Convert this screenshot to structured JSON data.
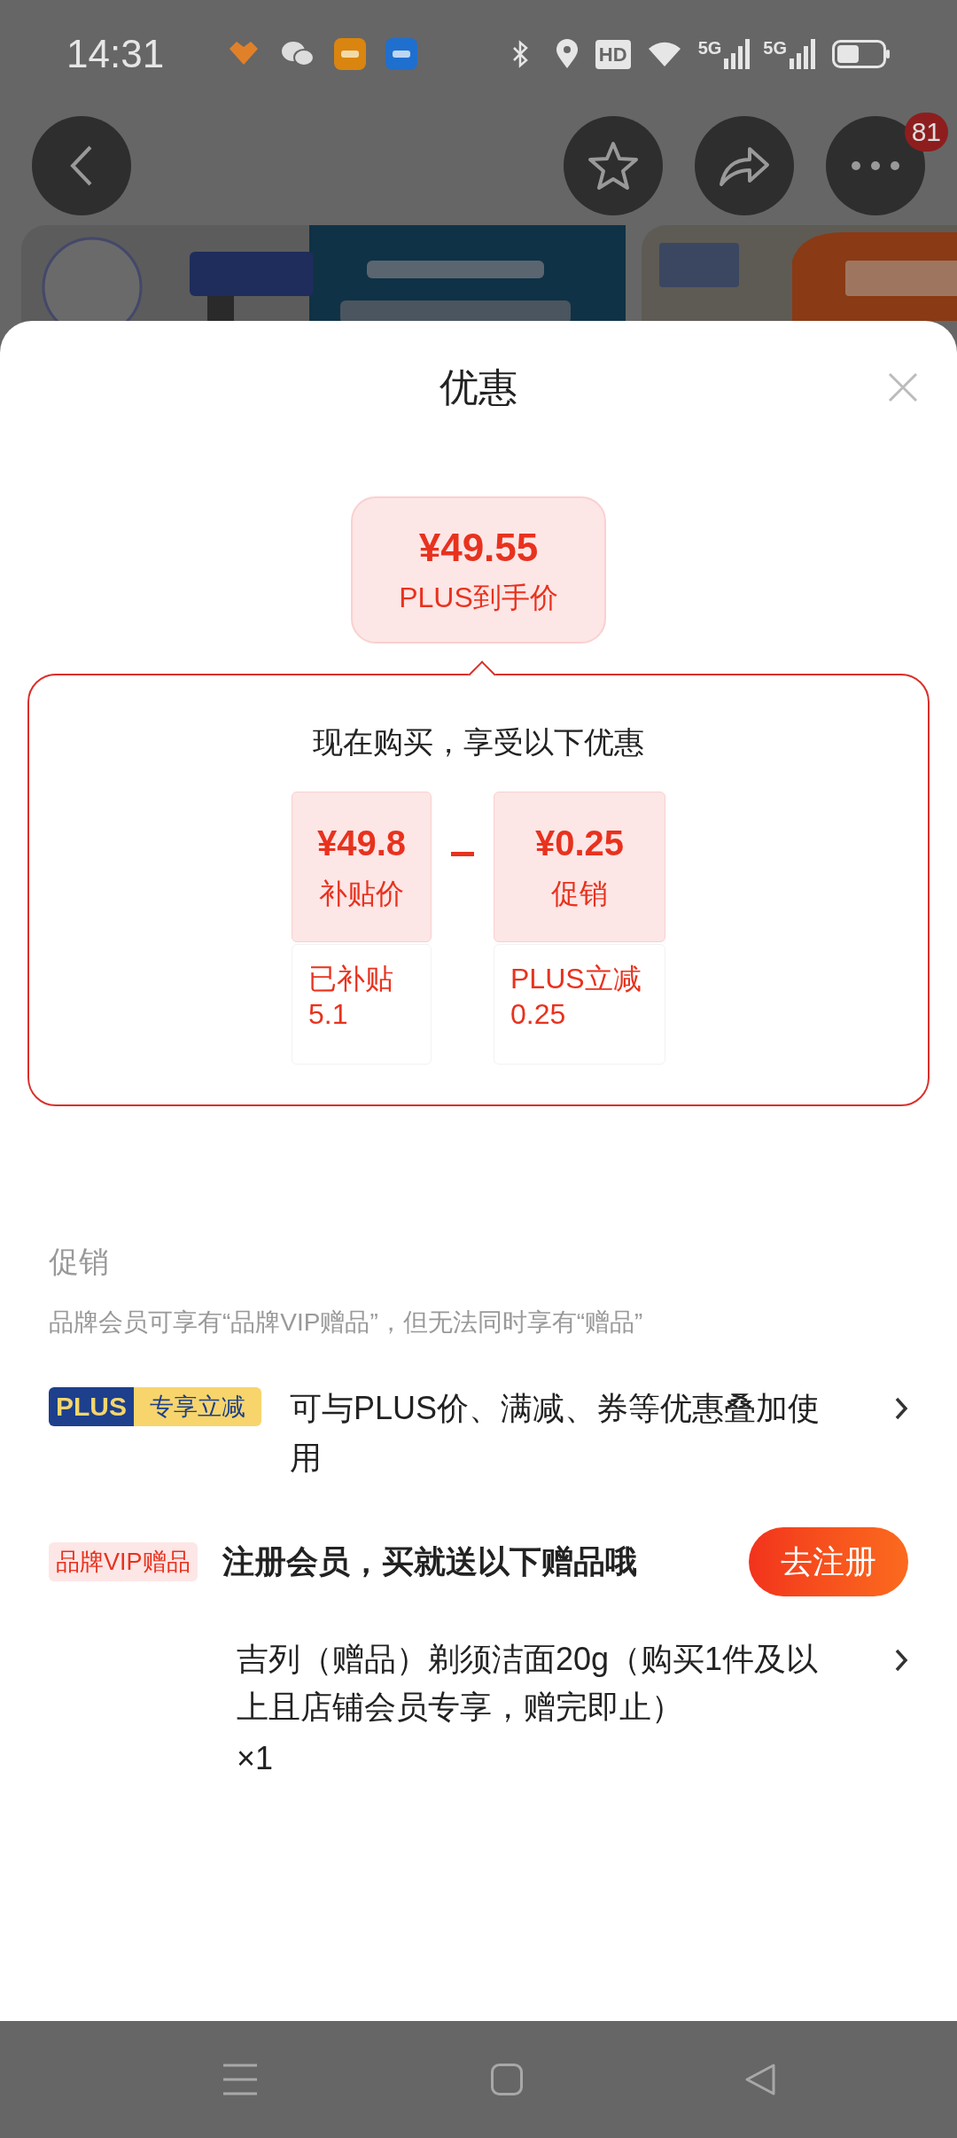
{
  "status_bar": {
    "time": "14:31",
    "hd_label": "HD",
    "network_labels": [
      "5G",
      "5G"
    ]
  },
  "header": {
    "notification_count": "81"
  },
  "sheet": {
    "title": "优惠"
  },
  "final_price": {
    "amount": "¥49.55",
    "label": "PLUS到手价"
  },
  "breakdown": {
    "heading": "现在购买，享受以下优惠",
    "items": [
      {
        "amount": "¥49.8",
        "label": "补贴价",
        "detail_lines": [
          "已补贴",
          "5.1"
        ]
      },
      {
        "amount": "¥0.25",
        "label": "促销",
        "detail_lines": [
          "PLUS立减",
          "0.25"
        ]
      }
    ]
  },
  "promotions": {
    "title": "促销",
    "note": "品牌会员可享有“品牌VIP赠品”，但无法同时享有“赠品”",
    "rows": [
      {
        "kind": "plus",
        "badge_parts": [
          "PLUS",
          "专享立减"
        ],
        "text": "可与PLUS价、满减、券等优惠叠加使用"
      },
      {
        "kind": "vip",
        "badge": "品牌VIP赠品",
        "text": "注册会员，买就送以下赠品哦",
        "button": "去注册"
      }
    ],
    "gift": {
      "text": "吉列（赠品）剃须洁面20g（购买1件及以上且店铺会员专享，赠完即止）",
      "quantity": "×1"
    }
  }
}
